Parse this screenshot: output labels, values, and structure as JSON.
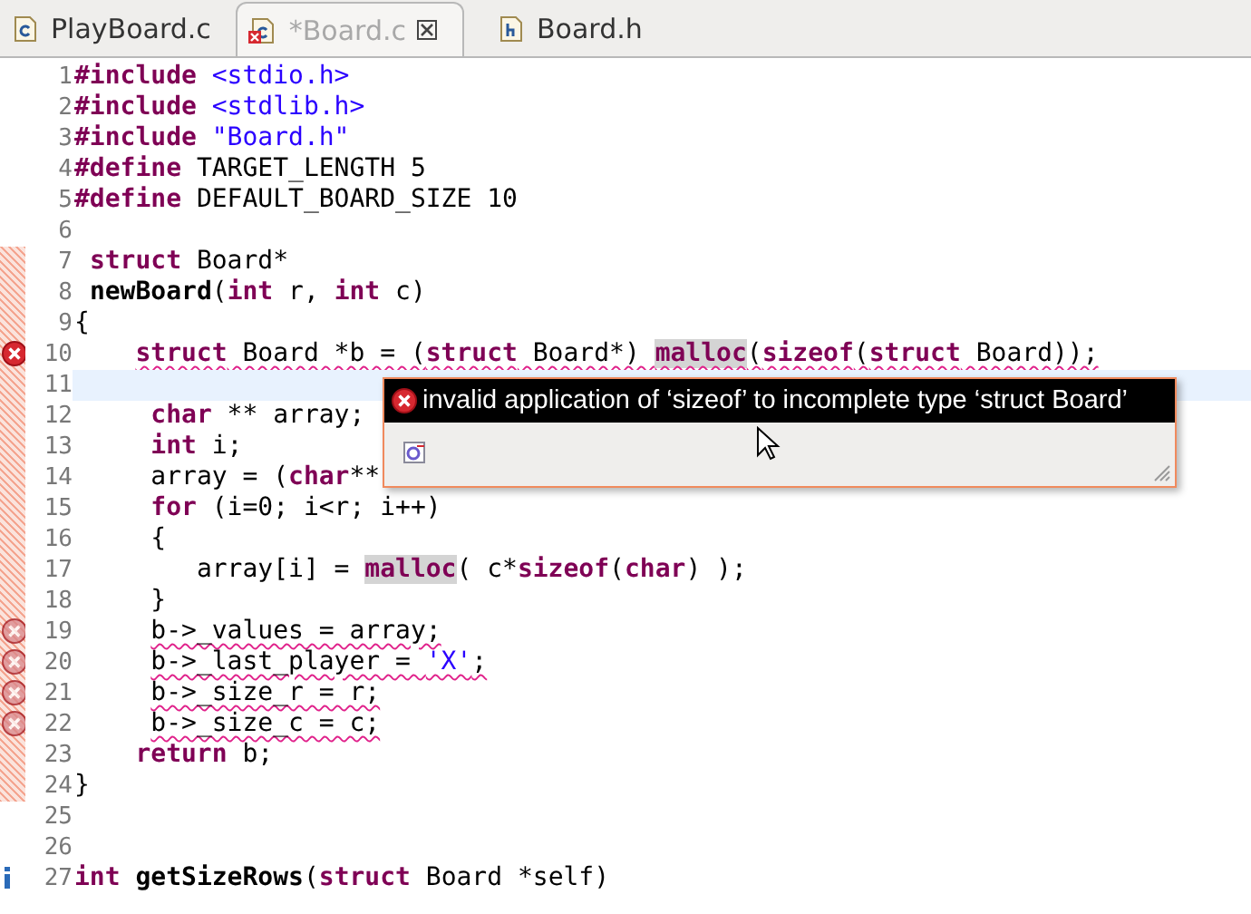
{
  "tabs": [
    {
      "label": "PlayBoard.c",
      "kind": "source",
      "selected": false,
      "error": false
    },
    {
      "label": "*Board.c",
      "kind": "source",
      "selected": true,
      "error": true
    },
    {
      "label": "Board.h",
      "kind": "header",
      "selected": false,
      "error": false
    }
  ],
  "editor": {
    "lines": [
      {
        "number": "1",
        "kind": "plain",
        "tokens": [
          {
            "kind": "pp",
            "text": "#include"
          },
          {
            "kind": "str",
            "text": " <stdio.h>"
          }
        ]
      },
      {
        "number": "2",
        "kind": "plain",
        "tokens": [
          {
            "kind": "pp",
            "text": "#include"
          },
          {
            "kind": "str",
            "text": " <stdlib.h>"
          }
        ]
      },
      {
        "number": "3",
        "kind": "plain",
        "tokens": [
          {
            "kind": "pp",
            "text": "#include"
          },
          {
            "kind": "str",
            "text": " \"Board.h\""
          }
        ]
      },
      {
        "number": "4",
        "kind": "plain",
        "tokens": [
          {
            "kind": "pp",
            "text": "#define"
          },
          {
            "kind": "txt",
            "text": " TARGET_LENGTH 5"
          }
        ]
      },
      {
        "number": "5",
        "kind": "plain",
        "tokens": [
          {
            "kind": "pp",
            "text": "#define"
          },
          {
            "kind": "txt",
            "text": " DEFAULT_BOARD_SIZE 10"
          }
        ]
      },
      {
        "number": "6",
        "kind": "plain"
      },
      {
        "number": "7",
        "kind": "plain",
        "flagged": true,
        "tokens": [
          {
            "kind": "kw",
            "text": " struct"
          },
          {
            "kind": "txt",
            "text": " Board*"
          }
        ]
      },
      {
        "number": "8",
        "kind": "plain",
        "flagged": true,
        "tokens": [
          {
            "kind": "fn",
            "text": " newBoard"
          },
          {
            "kind": "txt",
            "text": "("
          },
          {
            "kind": "kw",
            "text": "int"
          },
          {
            "kind": "txt",
            "text": " r, "
          },
          {
            "kind": "kw",
            "text": "int"
          },
          {
            "kind": "txt",
            "text": " c)"
          }
        ]
      },
      {
        "number": "9",
        "kind": "plain",
        "flagged": true,
        "tokens": [
          {
            "kind": "txt",
            "text": "{"
          }
        ]
      },
      {
        "number": "10",
        "kind": "error",
        "flagged": true,
        "squiggly": true,
        "tokens": [
          {
            "kind": "kw",
            "text": "    struct"
          },
          {
            "kind": "txt",
            "text": " Board *b = ("
          },
          {
            "kind": "kw",
            "text": "struct"
          },
          {
            "kind": "txt",
            "text": " Board*) "
          },
          {
            "kind": "hl",
            "text": "malloc"
          },
          {
            "kind": "txt",
            "text": "("
          },
          {
            "kind": "kw",
            "text": "sizeof"
          },
          {
            "kind": "txt",
            "text": "("
          },
          {
            "kind": "kw",
            "text": "struct"
          },
          {
            "kind": "txt",
            "text": " Board));"
          }
        ]
      },
      {
        "number": "11",
        "kind": "plain",
        "flagged": true,
        "current": true
      },
      {
        "number": "12",
        "kind": "plain",
        "flagged": true,
        "tokens": [
          {
            "kind": "kw",
            "text": "     char"
          },
          {
            "kind": "txt",
            "text": " ** array;"
          }
        ]
      },
      {
        "number": "13",
        "kind": "plain",
        "flagged": true,
        "tokens": [
          {
            "kind": "kw",
            "text": "     int"
          },
          {
            "kind": "txt",
            "text": " i;"
          }
        ]
      },
      {
        "number": "14",
        "kind": "plain",
        "flagged": true,
        "tokens": [
          {
            "kind": "txt",
            "text": "     array = ("
          },
          {
            "kind": "kw",
            "text": "char"
          },
          {
            "kind": "txt",
            "text": "**"
          }
        ]
      },
      {
        "number": "15",
        "kind": "plain",
        "flagged": true,
        "tokens": [
          {
            "kind": "kw",
            "text": "     for"
          },
          {
            "kind": "txt",
            "text": " (i=0; i<r; i++)"
          }
        ]
      },
      {
        "number": "16",
        "kind": "plain",
        "flagged": true,
        "tokens": [
          {
            "kind": "txt",
            "text": "     {"
          }
        ]
      },
      {
        "number": "17",
        "kind": "plain",
        "flagged": true,
        "tokens": [
          {
            "kind": "txt",
            "text": "        array[i] = "
          },
          {
            "kind": "hl",
            "text": "malloc"
          },
          {
            "kind": "txt",
            "text": "( c*"
          },
          {
            "kind": "kw",
            "text": "sizeof"
          },
          {
            "kind": "txt",
            "text": "("
          },
          {
            "kind": "kw",
            "text": "char"
          },
          {
            "kind": "txt",
            "text": ") );"
          }
        ]
      },
      {
        "number": "18",
        "kind": "plain",
        "flagged": true,
        "tokens": [
          {
            "kind": "txt",
            "text": "     }"
          }
        ]
      },
      {
        "number": "19",
        "kind": "stale",
        "flagged": true,
        "squiggly": true,
        "tokens": [
          {
            "kind": "txt",
            "text": "     b->_values = array;"
          }
        ]
      },
      {
        "number": "20",
        "kind": "stale",
        "flagged": true,
        "squiggly": true,
        "tokens": [
          {
            "kind": "txt",
            "text": "     b->_last_player = "
          },
          {
            "kind": "str",
            "text": "'X'"
          },
          {
            "kind": "txt",
            "text": ";"
          }
        ]
      },
      {
        "number": "21",
        "kind": "stale",
        "flagged": true,
        "squiggly": true,
        "tokens": [
          {
            "kind": "txt",
            "text": "     b->_size_r = r;"
          }
        ]
      },
      {
        "number": "22",
        "kind": "stale",
        "flagged": true,
        "squiggly": true,
        "tokens": [
          {
            "kind": "txt",
            "text": "     b->_size_c = c;"
          }
        ]
      },
      {
        "number": "23",
        "kind": "plain",
        "flagged": true,
        "tokens": [
          {
            "kind": "kw",
            "text": "    return"
          },
          {
            "kind": "txt",
            "text": " b;"
          }
        ]
      },
      {
        "number": "24",
        "kind": "plain",
        "flagged": true,
        "tokens": [
          {
            "kind": "txt",
            "text": "}"
          }
        ]
      },
      {
        "number": "25",
        "kind": "plain"
      },
      {
        "number": "26",
        "kind": "plain"
      },
      {
        "number": "27",
        "kind": "info",
        "tokens": [
          {
            "kind": "kw",
            "text": "int"
          },
          {
            "kind": "fn",
            "text": " getSizeRows"
          },
          {
            "kind": "txt",
            "text": "("
          },
          {
            "kind": "kw",
            "text": "struct"
          },
          {
            "kind": "txt",
            "text": " Board *self)"
          }
        ]
      }
    ]
  },
  "hover": {
    "message": "invalid application of ‘sizeof’ to incomplete type ‘struct Board’"
  }
}
